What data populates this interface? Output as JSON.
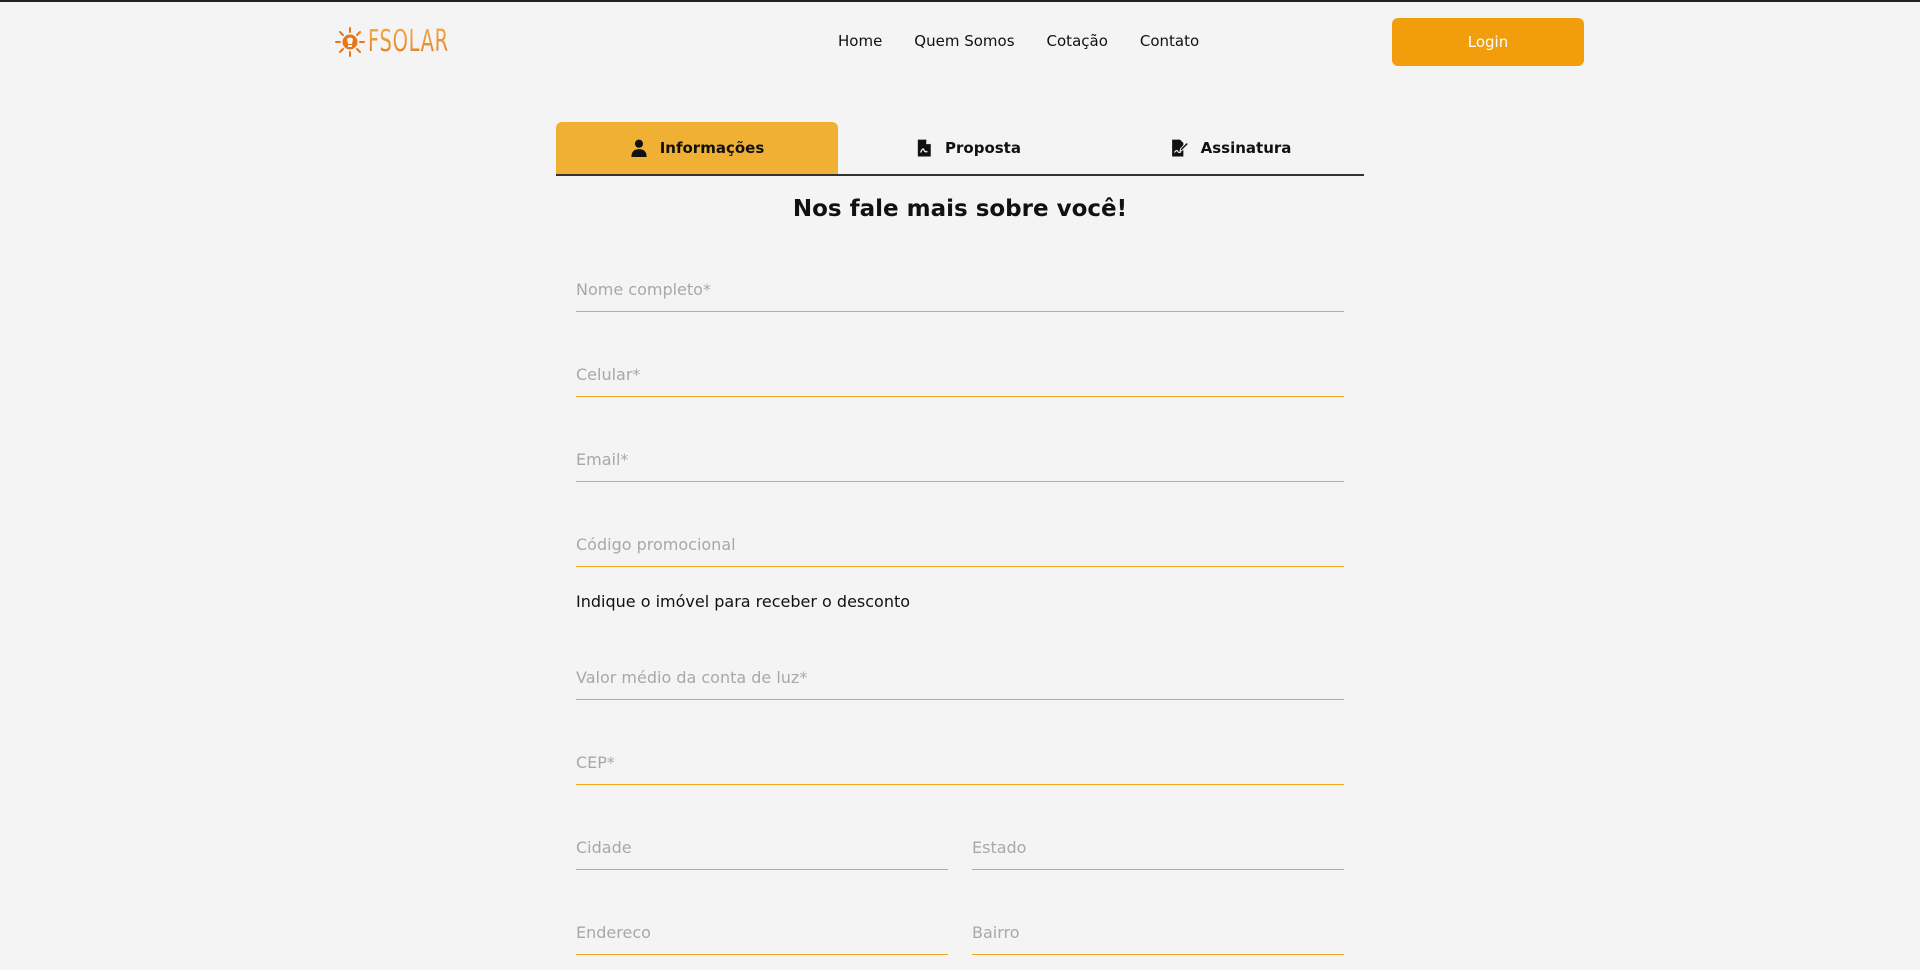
{
  "header": {
    "logo_text": "FSOLAR",
    "nav": [
      "Home",
      "Quem Somos",
      "Cotação",
      "Contato"
    ],
    "login_label": "Login"
  },
  "tabs": [
    {
      "label": "Informações",
      "icon": "user-icon",
      "active": true
    },
    {
      "label": "Proposta",
      "icon": "file-pdf-icon",
      "active": false
    },
    {
      "label": "Assinatura",
      "icon": "signature-icon",
      "active": false
    }
  ],
  "form": {
    "title": "Nos fale mais sobre você!",
    "fields": {
      "nome": {
        "placeholder": "Nome completo*",
        "value": ""
      },
      "celular": {
        "placeholder": "Celular*",
        "value": ""
      },
      "email": {
        "placeholder": "Email*",
        "value": ""
      },
      "promo": {
        "placeholder": "Código promocional",
        "value": ""
      },
      "conta": {
        "placeholder": "Valor médio da conta de luz*",
        "value": ""
      },
      "cep": {
        "placeholder": "CEP*",
        "value": ""
      },
      "cidade": {
        "placeholder": "Cidade",
        "value": ""
      },
      "estado": {
        "placeholder": "Estado",
        "value": ""
      },
      "endereco": {
        "placeholder": "Endereco",
        "value": ""
      },
      "bairro": {
        "placeholder": "Bairro",
        "value": ""
      }
    },
    "hint": "Indique o imóvel para receber o desconto"
  },
  "colors": {
    "accent": "#f29e0c",
    "tab_active": "#f0b033",
    "field_border": "#f0a820",
    "background": "#f4f4f4"
  }
}
